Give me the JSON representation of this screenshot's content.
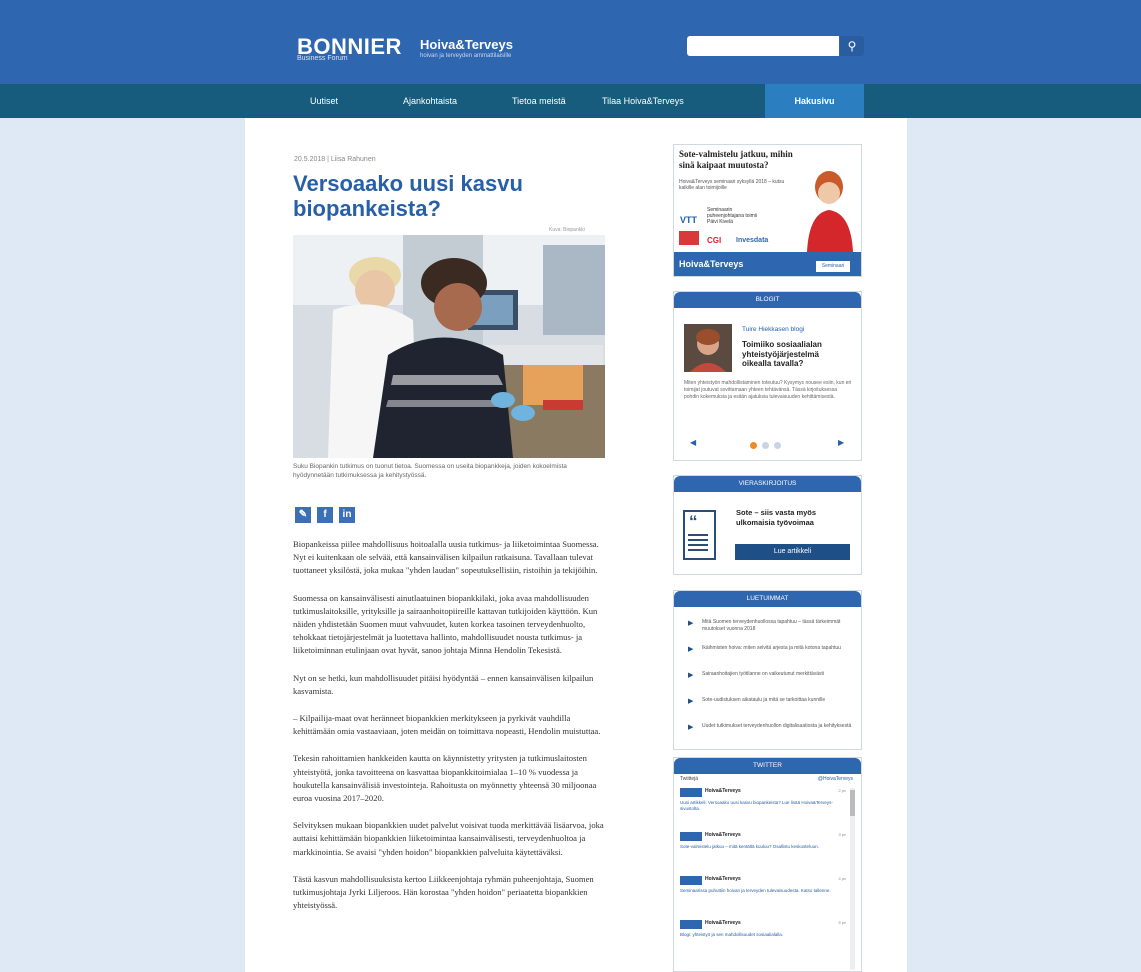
{
  "header": {
    "brand": "BONNIER",
    "brand_sub": "Business Forum",
    "publication": "Hoiva&Terveys",
    "publication_sub": "hoivan ja terveyden ammattilaisille",
    "search_placeholder": "",
    "search_icon": "magnifier-icon"
  },
  "nav": {
    "items": [
      "Uutiset",
      "Ajankohtaista",
      "Tietoa meistä",
      "Tilaa Hoiva&Terveys"
    ],
    "active": "Hakusivu"
  },
  "article": {
    "meta": "20.5.2018 | Liisa Rahunen",
    "title": "Versoaako uusi kasvu biopankeista?",
    "photo_credit": "Kuva: Biopankki",
    "caption": "Suku Biopankin tutkimus on tuonut tietoa. Suomessa on useita biopankkeja, joiden kokoelmista hyödynnetään tutkimuksessa ja kehitystyössä.",
    "share": [
      "twitter",
      "facebook",
      "linkedin"
    ],
    "paragraphs": [
      "Biopankeissa piilee mahdollisuus hoitoalalla uusia tutkimus- ja liiketoimintaa Suomessa. Nyt ei kuitenkaan ole selvää, että kansainvälisen kilpailun ratkaisuna. Tavallaan tulevat tuottaneet yksilöstä, joka mukaa \"yhden laudan\" sopeutuksellisiin, ristoihin ja tekijöihin.",
      "Suomessa on kansainvälisesti ainutlaatuinen biopankkilaki, joka avaa mahdollisuuden tutkimuslaitoksille, yrityksille ja sairaanhoitopiireille kattavan tutkijoiden käyttöön. Kun näiden yhdistetään Suomen muut vahvuudet, kuten korkea tasoinen terveydenhuolto, tehokkaat tietojärjestelmät ja luotettava hallinto, mahdollisuudet nousta tutkimus- ja liiketoiminnan etulinjaan ovat hyvät, sanoo johtaja Minna Hendolin Tekesistä.",
      "Nyt on se hetki, kun mahdollisuudet pitäisi hyödyntää – ennen kansainvälisen kilpailun kasvamista.",
      "– Kilpailija-maat ovat heränneet biopankkien merkitykseen ja pyrkivät vauhdilla kehittämään omia vastaaviaan, joten meidän on toimittava nopeasti, Hendolin muistuttaa.",
      "Tekesin rahoittamien hankkeiden kautta on käynnistetty yritysten ja tutkimuslaitosten yhteistyötä, jonka tavoitteena on kasvattaa biopankkitoimialaa 1–10 % vuodessa ja houkutella kansainvälisiä investointeja. Rahoitusta on myönnetty yhteensä 30 miljoonaa euroa vuosina 2017–2020.",
      "Selvityksen mukaan biopankkien uudet palvelut voisivat tuoda merkittävää lisäarvoa, joka auttaisi kehittämään biopankkien liiketoimintaa kansainvälisesti, terveydenhuoltoa ja markkinointia. Se avaisi \"yhden hoidon\" biopankkien palveluita käytettäväksi.",
      "Tästä kasvun mahdollisuuksista kertoo Liikkeenjohtaja ryhmän puheenjohtaja, Suomen tutkimusjohtaja Jyrki Liljeroos. Hän korostaa \"yhden hoidon\" periaatetta biopankkien yhteistyössä."
    ]
  },
  "sidebar": {
    "ad": {
      "title": "Sote-valmistelu jatkuu, mihin sinä kaipaat muutosta?",
      "subtitle": "Hoiva&Terveys seminaari syksyllä 2018 – kutsu kaikille alan toimijoille",
      "person": "Seminaarin puheenjohtajana toimii Päivi Kivelä",
      "logos": [
        "VTT",
        "CGI",
        "Invesdata"
      ],
      "banner": "Hoiva&Terveys",
      "banner_tag": "Seminaari"
    },
    "blogs": {
      "heading": "BLOGIT",
      "author": "Tuire Hiekkasen blogi",
      "title": "Toimiiko sosiaalialan yhteistyöjärjestelmä oikealla tavalla?",
      "excerpt": "Miten yhteistyön mahdollistaminen toteutuu? Kysymys nousee esiin, kun eri toimijat joutuvat sovittamaan yhteen tehtävänsä. Tässä kirjoituksessa pohdin kokemuksia ja esitän ajatuksia tulevaisuuden kehittämisestä."
    },
    "opinion": {
      "heading": "VIERASKIRJOITUS",
      "title": "Sote – siis vasta myös ulkomaisia työvoimaa",
      "button": "Lue artikkeli"
    },
    "popular": {
      "heading": "LUETUIMMAT",
      "items": [
        "Mitä Suomen terveydenhuollossa tapahtuu – tässä tärkeimmät muutokset vuonna 2018",
        "Ikäihmisten hoiva: miten selvitä arjesta ja mitä kotona tapahtuu",
        "Sairaanhoitajien työtilanne on vaikeutunut merkittävästi",
        "Sote-uudistuksen aikataulu ja mitä se tarkoittaa kunnille",
        "Uudet tutkimukset terveydenhuollon digitalisaatiosta ja kehityksestä"
      ]
    },
    "twitter": {
      "heading": "TWITTER",
      "left": "Twiittejä",
      "right": "@HoivaTerveys",
      "tweets": [
        {
          "name": "Hoiva&Terveys",
          "date": "2 pv",
          "text": "Uusi artikkeli: Versoaako uusi kasvu biopankeista? Lue lisää Hoiva&Terveys-sivustolta."
        },
        {
          "name": "Hoiva&Terveys",
          "date": "3 pv",
          "text": "Sote-valmistelu jatkuu – mitä kentältä kuuluu? Osallistu keskusteluun."
        },
        {
          "name": "Hoiva&Terveys",
          "date": "4 pv",
          "text": "Seminaarissa puhuttiin hoivan ja terveyden tulevaisuudesta. Katso tallenne."
        },
        {
          "name": "Hoiva&Terveys",
          "date": "5 pv",
          "text": "Blogi: yhteistyö ja sen mahdollisuudet sosiaalialalla."
        }
      ]
    }
  }
}
